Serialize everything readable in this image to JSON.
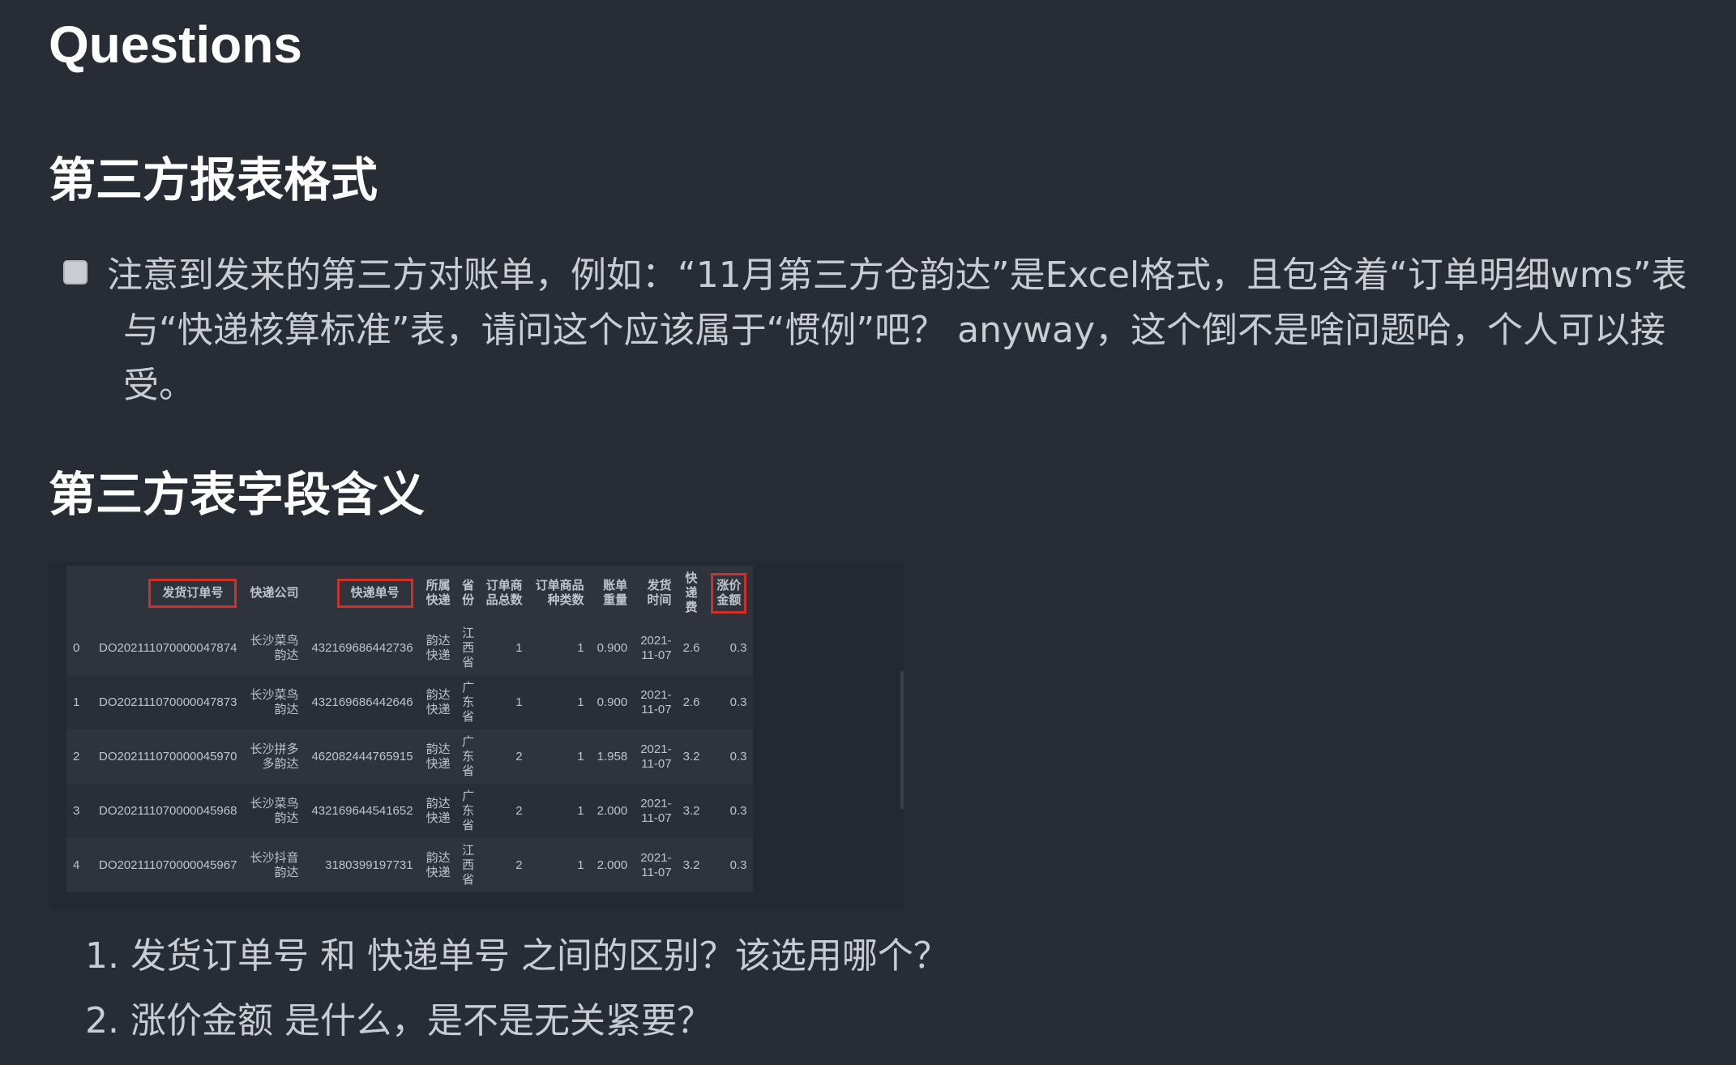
{
  "title": "Questions",
  "section1": {
    "heading": "第三方报表格式",
    "task": {
      "checked": false,
      "line1": "注意到发来的第三方对账单，例如：“11月第三方仓韵达”是Excel格式，且包含着“订单明细wms”表",
      "line2": "与“快递核算标准”表，请问这个应该属于“惯例”吧？ anyway，这个倒不是啥问题哈，个人可以接",
      "line3": "受。"
    }
  },
  "section2": {
    "heading": "第三方表字段含义",
    "table": {
      "headers": [
        "",
        "发货订单号",
        "快递公司",
        "快递单号",
        "所属\n快递",
        "省\n份",
        "订单商\n品总数",
        "订单商品\n种类数",
        "账单\n重量",
        "发货\n时间",
        "快\n递\n费",
        "涨价\n金额"
      ],
      "rows": [
        [
          "0",
          "DO202111070000047874",
          "长沙菜鸟\n韵达",
          "432169686442736",
          "韵达\n快递",
          "江\n西\n省",
          "1",
          "1",
          "0.900",
          "2021-\n11-07",
          "2.6",
          "0.3"
        ],
        [
          "1",
          "DO202111070000047873",
          "长沙菜鸟\n韵达",
          "432169686442646",
          "韵达\n快递",
          "广\n东\n省",
          "1",
          "1",
          "0.900",
          "2021-\n11-07",
          "2.6",
          "0.3"
        ],
        [
          "2",
          "DO202111070000045970",
          "长沙拼多\n多韵达",
          "462082444765915",
          "韵达\n快递",
          "广\n东\n省",
          "2",
          "1",
          "1.958",
          "2021-\n11-07",
          "3.2",
          "0.3"
        ],
        [
          "3",
          "DO202111070000045968",
          "长沙菜鸟\n韵达",
          "432169644541652",
          "韵达\n快递",
          "广\n东\n省",
          "2",
          "1",
          "2.000",
          "2021-\n11-07",
          "3.2",
          "0.3"
        ],
        [
          "4",
          "DO202111070000045967",
          "长沙抖音\n韵达",
          "3180399197731",
          "韵达\n快递",
          "江\n西\n省",
          "2",
          "1",
          "2.000",
          "2021-\n11-07",
          "3.2",
          "0.3"
        ]
      ],
      "highlighted_columns": [
        "发货订单号",
        "快递单号",
        "涨价金额"
      ],
      "highlight_color": "#d0302a"
    },
    "questions": [
      "1. 发货订单号 和 快递单号 之间的区别？该选用哪个？",
      "2. 涨价金额 是什么，是不是无关紧要？"
    ]
  },
  "colors": {
    "background": "#282c34",
    "text": "#c9ccd3",
    "heading": "#ffffff"
  }
}
